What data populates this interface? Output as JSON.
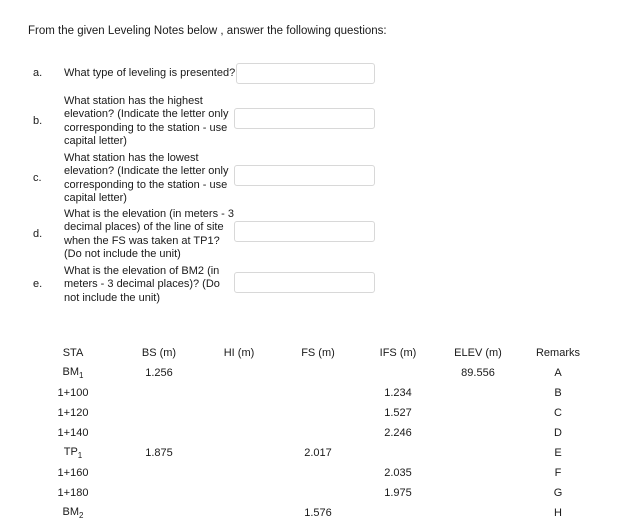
{
  "heading": "From the given Leveling Notes below , answer the  following questions:",
  "questions": [
    {
      "letter": "a.",
      "text": "What type of leveling is presented?",
      "answer_value": "",
      "answer_placeholder": ""
    },
    {
      "letter": "b.",
      "text": "What station has the highest elevation? (Indicate the letter only corresponding to the station - use capital letter)",
      "answer_value": "",
      "answer_placeholder": ""
    },
    {
      "letter": "c.",
      "text": "What station has the lowest elevation? (Indicate the letter only corresponding to the station - use capital letter)",
      "answer_value": "",
      "answer_placeholder": ""
    },
    {
      "letter": "d.",
      "text": "What is the elevation (in meters - 3 decimal places) of the line of site when the FS was taken at TP1? (Do not include the unit)",
      "answer_value": "",
      "answer_placeholder": ""
    },
    {
      "letter": "e.",
      "text": "What is the elevation of BM2 (in meters - 3 decimal places)? (Do not include the unit)",
      "answer_value": "",
      "answer_placeholder": ""
    }
  ],
  "table": {
    "headers": {
      "sta": "STA",
      "bs": "BS (m)",
      "hi": "HI  (m)",
      "fs": "FS  (m)",
      "ifs": "IFS  (m)",
      "elev": "ELEV  (m)",
      "remarks": "Remarks"
    },
    "rows": [
      {
        "sta_base": "BM",
        "sta_sub": "1",
        "bs": "1.256",
        "hi": "",
        "fs": "",
        "ifs": "",
        "elev": "89.556",
        "remarks": "A"
      },
      {
        "sta_base": "1+100",
        "sta_sub": "",
        "bs": "",
        "hi": "",
        "fs": "",
        "ifs": "1.234",
        "elev": "",
        "remarks": "B"
      },
      {
        "sta_base": "1+120",
        "sta_sub": "",
        "bs": "",
        "hi": "",
        "fs": "",
        "ifs": "1.527",
        "elev": "",
        "remarks": "C"
      },
      {
        "sta_base": "1+140",
        "sta_sub": "",
        "bs": "",
        "hi": "",
        "fs": "",
        "ifs": "2.246",
        "elev": "",
        "remarks": "D"
      },
      {
        "sta_base": "TP",
        "sta_sub": "1",
        "bs": "1.875",
        "hi": "",
        "fs": "2.017",
        "ifs": "",
        "elev": "",
        "remarks": "E"
      },
      {
        "sta_base": "1+160",
        "sta_sub": "",
        "bs": "",
        "hi": "",
        "fs": "",
        "ifs": "2.035",
        "elev": "",
        "remarks": "F"
      },
      {
        "sta_base": "1+180",
        "sta_sub": "",
        "bs": "",
        "hi": "",
        "fs": "",
        "ifs": "1.975",
        "elev": "",
        "remarks": "G"
      },
      {
        "sta_base": "BM",
        "sta_sub": "2",
        "bs": "",
        "hi": "",
        "fs": "1.576",
        "ifs": "",
        "elev": "",
        "remarks": "H"
      }
    ]
  },
  "colors": {
    "text": "#1a1a1a",
    "input_border": "#d8d8d8",
    "background": "#ffffff"
  }
}
